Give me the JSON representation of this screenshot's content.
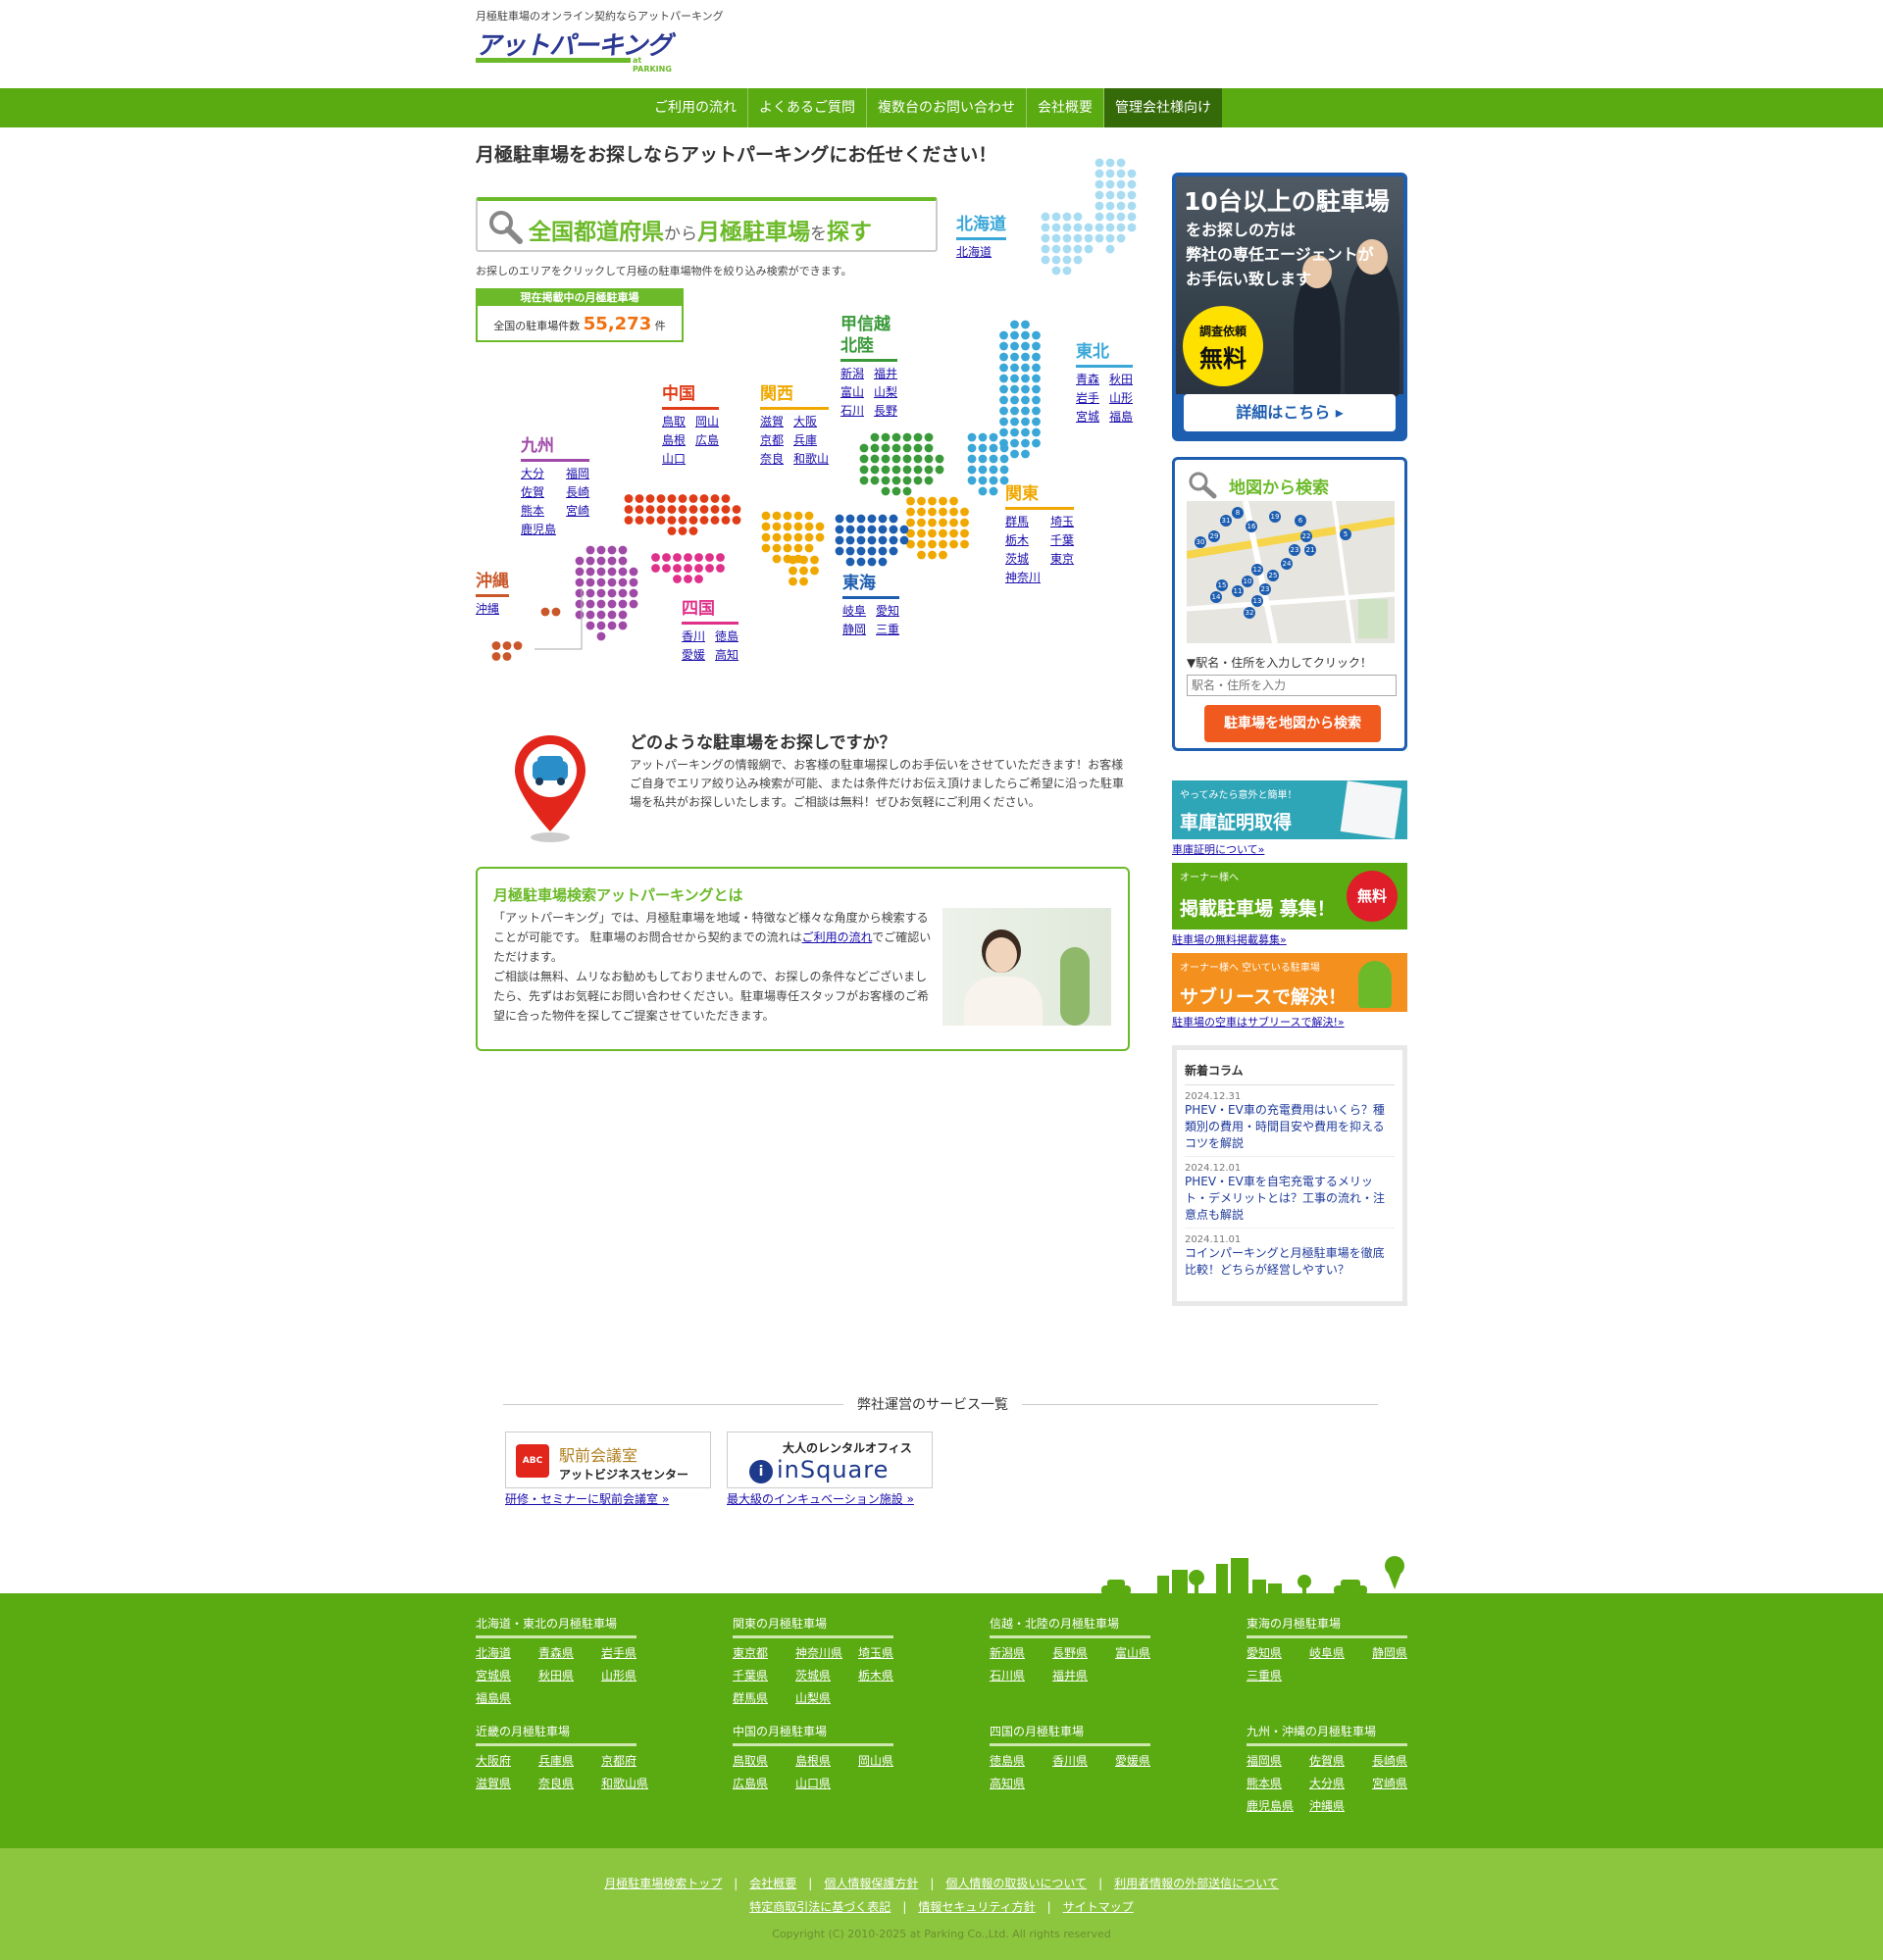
{
  "header": {
    "tagline": "月極駐車場のオンライン契約ならアットパーキング",
    "logo_text": "アットパーキング",
    "logo_sub": "at PARKING"
  },
  "nav": [
    "ご利用の流れ",
    "よくあるご質問",
    "複数台のお問い合わせ",
    "会社概要",
    "管理会社様向け"
  ],
  "main_heading": "月極駐車場をお探しならアットパーキングにお任せください！",
  "search": {
    "title_a": "全国都道府県",
    "title_b": "から",
    "title_c": "月極駐車場",
    "title_d": "を",
    "title_e": "探す",
    "description": "お探しのエリアをクリックして月極の駐車場物件を絞り込み検索ができます。",
    "count_caption": "現在掲載中の月極駐車場",
    "count_prefix": "全国の駐車場件数",
    "count_value": "55,273",
    "count_unit": "件"
  },
  "regions": [
    {
      "name": "北海道",
      "color": "#3aa7d8",
      "prefs": [
        "北海道"
      ]
    },
    {
      "name": "東北",
      "color": "#3aa7d8",
      "prefs": [
        "青森",
        "秋田",
        "岩手",
        "山形",
        "宮城",
        "福島"
      ]
    },
    {
      "name": "甲信越\n北陸",
      "color": "#3a9a3a",
      "prefs": [
        "新潟",
        "福井",
        "富山",
        "山梨",
        "石川",
        "長野"
      ]
    },
    {
      "name": "関東",
      "color": "#f0a800",
      "prefs": [
        "群馬",
        "埼玉",
        "栃木",
        "千葉",
        "茨城",
        "東京",
        "神奈川"
      ]
    },
    {
      "name": "東海",
      "color": "#1e5eb0",
      "prefs": [
        "岐阜",
        "愛知",
        "静岡",
        "三重"
      ]
    },
    {
      "name": "関西",
      "color": "#f0a800",
      "prefs": [
        "滋賀",
        "大阪",
        "京都",
        "兵庫",
        "奈良",
        "和歌山"
      ]
    },
    {
      "name": "中国",
      "color": "#e03c18",
      "prefs": [
        "鳥取",
        "岡山",
        "島根",
        "広島",
        "山口"
      ]
    },
    {
      "name": "四国",
      "color": "#e0308a",
      "prefs": [
        "香川",
        "徳島",
        "愛媛",
        "高知"
      ]
    },
    {
      "name": "九州",
      "color": "#a04aa8",
      "prefs": [
        "大分",
        "福岡",
        "佐賀",
        "長崎",
        "熊本",
        "宮崎",
        "鹿児島"
      ]
    },
    {
      "name": "沖縄",
      "color": "#c9572a",
      "prefs": [
        "沖縄"
      ]
    }
  ],
  "banner_agent": {
    "title": "10台以上の駐車場",
    "line1": "をお探しの方は",
    "line2": "弊社の専任エージェントが",
    "line3": "お手伝い致します",
    "free_small": "調査依頼",
    "free_big": "無料",
    "button": "詳細はこちら ▸"
  },
  "map_search": {
    "title": "地図から検索",
    "label": "▼駅名・住所を入力してクリック！",
    "placeholder": "駅名・住所を入力",
    "button": "駐車場を地図から検索"
  },
  "side_banners": [
    {
      "small": "やってみたら意外と簡単！",
      "big": "車庫証明取得",
      "link": "車庫証明について»"
    },
    {
      "small": "オーナー様へ",
      "big": "掲載駐車場 募集！",
      "badge": "無料",
      "link": "駐車場の無料掲載募集»"
    },
    {
      "small": "オーナー様へ 空いている駐車場",
      "big": "サブリースで解決！",
      "link": "駐車場の空車はサブリースで解決!»"
    }
  ],
  "column": {
    "heading": "新着コラム",
    "items": [
      {
        "date": "2024.12.31",
        "title": "PHEV・EV車の充電費用はいくら？種類別の費用・時間目安や費用を抑えるコツを解説"
      },
      {
        "date": "2024.12.01",
        "title": "PHEV・EV車を自宅充電するメリット・デメリットとは？工事の流れ・注意点も解説"
      },
      {
        "date": "2024.11.01",
        "title": "コインパーキングと月極駐車場を徹底比較！どちらが経営しやすい？"
      }
    ]
  },
  "what": {
    "heading": "どのような駐車場をお探しですか？",
    "body": "アットパーキングの情報網で、お客様の駐車場探しのお手伝いをさせていただきます！お客様ご自身でエリア絞り込み検索が可能、または条件だけお伝え頂けましたらご希望に沿った駐車場を私共がお探しいたします。ご相談は無料！ぜひお気軽にご利用ください。"
  },
  "about": {
    "heading": "月極駐車場検索アットパーキングとは",
    "p1a": "「アットパーキング」では、月極駐車場を地域・特徴など様々な角度から検索することが可能です。 駐車場のお問合せから契約までの流れは",
    "p1link": "ご利用の流れ",
    "p1b": "でご確認いただけます。",
    "p2": "ご相談は無料、ムリなお勧めもしておりませんので、お探しの条件などございましたら、先ずはお気軽にお問い合わせください。駐車場専任スタッフがお客様のご希望に合った物件を探してご提案させていただきます。"
  },
  "services": {
    "heading": "弊社運営のサービス一覧",
    "items": [
      {
        "logo_a": "ABC",
        "title_a": "駅前会議室",
        "title_b": "アットビジネスセンター",
        "link": "研修・セミナーに駅前会議室 »"
      },
      {
        "title_a": "大人のレンタルオフィス",
        "title_b": "inSquare",
        "link": "最大級のインキュベーション施設 »"
      }
    ]
  },
  "footer": {
    "groups": [
      {
        "h": "北海道・東北の月極駐車場",
        "links": [
          "北海道",
          "青森県",
          "岩手県",
          "宮城県",
          "秋田県",
          "山形県",
          "福島県"
        ]
      },
      {
        "h": "関東の月極駐車場",
        "links": [
          "東京都",
          "神奈川県",
          "埼玉県",
          "千葉県",
          "茨城県",
          "栃木県",
          "群馬県",
          "山梨県"
        ]
      },
      {
        "h": "信越・北陸の月極駐車場",
        "links": [
          "新潟県",
          "長野県",
          "富山県",
          "石川県",
          "福井県"
        ]
      },
      {
        "h": "東海の月極駐車場",
        "links": [
          "愛知県",
          "岐阜県",
          "静岡県",
          "三重県"
        ]
      },
      {
        "h": "近畿の月極駐車場",
        "links": [
          "大阪府",
          "兵庫県",
          "京都府",
          "滋賀県",
          "奈良県",
          "和歌山県"
        ]
      },
      {
        "h": "中国の月極駐車場",
        "links": [
          "鳥取県",
          "島根県",
          "岡山県",
          "広島県",
          "山口県"
        ]
      },
      {
        "h": "四国の月極駐車場",
        "links": [
          "徳島県",
          "香川県",
          "愛媛県",
          "高知県"
        ]
      },
      {
        "h": "九州・沖縄の月極駐車場",
        "links": [
          "福岡県",
          "佐賀県",
          "長崎県",
          "熊本県",
          "大分県",
          "宮崎県",
          "鹿児島県",
          "沖縄県"
        ]
      }
    ],
    "links_row1": [
      "月極駐車場検索トップ",
      "会社概要",
      "個人情報保護方針",
      "個人情報の取扱いについて",
      "利用者情報の外部送信について"
    ],
    "links_row2": [
      "特定商取引法に基づく表記",
      "情報セキュリティ方針",
      "サイトマップ"
    ],
    "copyright": "Copyright (C) 2010-2025 at Parking Co.,Ltd. All rights reserved"
  },
  "colors": {
    "green": "#5aaa12",
    "lightgreen": "#8cc63f",
    "blue": "#1e5eb0",
    "orange": "#f05a1e"
  }
}
